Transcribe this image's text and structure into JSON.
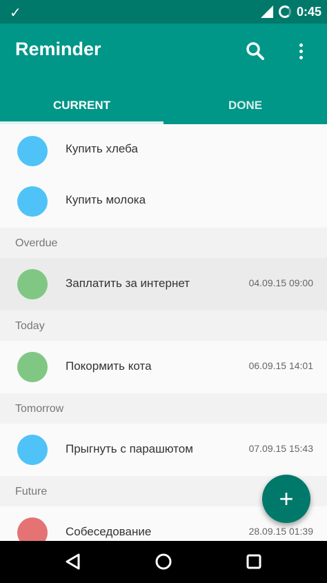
{
  "status_bar": {
    "time": "0:45",
    "icons": [
      "check-icon",
      "signal-icon",
      "battery-icon"
    ]
  },
  "app_bar": {
    "title": "Reminder",
    "actions": [
      "search-icon",
      "more-vert-icon"
    ]
  },
  "tabs": [
    {
      "label": "CURRENT",
      "selected": true
    },
    {
      "label": "DONE",
      "selected": false
    }
  ],
  "list": {
    "ungrouped": [
      {
        "title": "Купить хлеба",
        "date": "",
        "color": "#4fc3f7"
      },
      {
        "title": "Купить молока",
        "date": "",
        "color": "#4fc3f7"
      }
    ],
    "overdue": {
      "header": "Overdue",
      "items": [
        {
          "title": "Заплатить за интернет",
          "date": "04.09.15 09:00",
          "color": "#81c784"
        }
      ]
    },
    "today": {
      "header": "Today",
      "items": [
        {
          "title": "Покормить кота",
          "date": "06.09.15 14:01",
          "color": "#81c784"
        }
      ]
    },
    "tomorrow": {
      "header": "Tomorrow",
      "items": [
        {
          "title": "Прыгнуть с парашютом",
          "date": "07.09.15 15:43",
          "color": "#4fc3f7"
        }
      ]
    },
    "future": {
      "header": "Future",
      "items": [
        {
          "title": "Собеседование",
          "date": "28.09.15 01:39",
          "color": "#e57373"
        }
      ]
    }
  },
  "fab": {
    "label": "+"
  },
  "colors": {
    "primary": "#009688",
    "primary_dark": "#00796b",
    "accent_blue": "#4fc3f7",
    "accent_green": "#81c784",
    "accent_red": "#e57373"
  },
  "nav_bar": {
    "icons": [
      "back-icon",
      "home-icon",
      "recent-apps-icon"
    ]
  }
}
